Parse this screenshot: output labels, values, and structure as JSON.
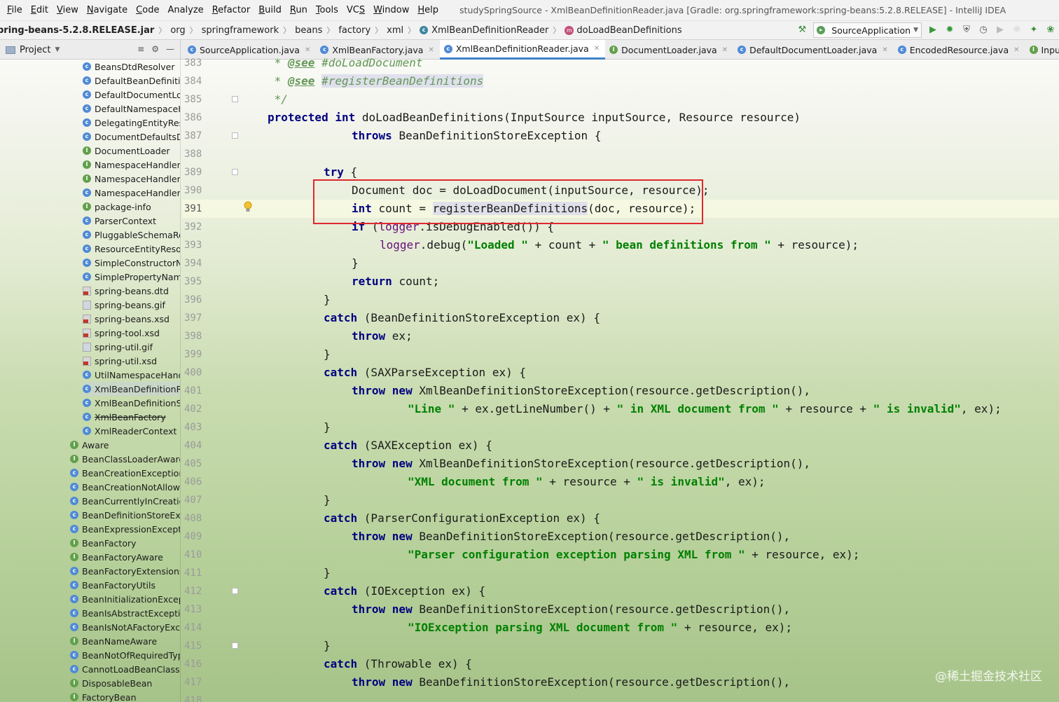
{
  "menu": {
    "items": [
      {
        "label": "File",
        "u": "F"
      },
      {
        "label": "Edit",
        "u": "E"
      },
      {
        "label": "View",
        "u": "V"
      },
      {
        "label": "Navigate",
        "u": "N"
      },
      {
        "label": "Code",
        "u": "C"
      },
      {
        "label": "Analyze",
        "u": ""
      },
      {
        "label": "Refactor",
        "u": "R"
      },
      {
        "label": "Build",
        "u": "B"
      },
      {
        "label": "Run",
        "u": "R"
      },
      {
        "label": "Tools",
        "u": "T"
      },
      {
        "label": "VCS",
        "u": "S"
      },
      {
        "label": "Window",
        "u": "W"
      },
      {
        "label": "Help",
        "u": "H"
      }
    ],
    "window_title": "studySpringSource - XmlBeanDefinitionReader.java [Gradle: org.springframework:spring-beans:5.2.8.RELEASE] - IntelliJ IDEA"
  },
  "breadcrumbs": [
    "pring-beans-5.2.8.RELEASE.jar",
    "org",
    "springframework",
    "beans",
    "factory",
    "xml",
    "XmlBeanDefinitionReader",
    "doLoadBeanDefinitions"
  ],
  "toolbar": {
    "run_config": "SourceApplication"
  },
  "project_panel": {
    "label": "Project"
  },
  "tabs": [
    {
      "label": "SourceApplication.java",
      "icon": "c"
    },
    {
      "label": "XmlBeanFactory.java",
      "icon": "c"
    },
    {
      "label": "XmlBeanDefinitionReader.java",
      "icon": "c",
      "active": true
    },
    {
      "label": "DocumentLoader.java",
      "icon": "i"
    },
    {
      "label": "DefaultDocumentLoader.java",
      "icon": "c"
    },
    {
      "label": "EncodedResource.java",
      "icon": "c"
    },
    {
      "label": "InputStreamSou",
      "icon": "i"
    }
  ],
  "tree": [
    {
      "label": "BeansDtdResolver",
      "icon": "c",
      "indent": 1
    },
    {
      "label": "DefaultBeanDefinition",
      "icon": "c",
      "indent": 1
    },
    {
      "label": "DefaultDocumentLoa",
      "icon": "c",
      "indent": 1
    },
    {
      "label": "DefaultNamespaceH",
      "icon": "c",
      "indent": 1
    },
    {
      "label": "DelegatingEntityResc",
      "icon": "c",
      "indent": 1
    },
    {
      "label": "DocumentDefaultsDe",
      "icon": "c",
      "indent": 1
    },
    {
      "label": "DocumentLoader",
      "icon": "i",
      "indent": 1
    },
    {
      "label": "NamespaceHandler",
      "icon": "i",
      "indent": 1
    },
    {
      "label": "NamespaceHandlerR",
      "icon": "i",
      "indent": 1
    },
    {
      "label": "NamespaceHandlerS",
      "icon": "c",
      "indent": 1
    },
    {
      "label": "package-info",
      "icon": "i",
      "indent": 1
    },
    {
      "label": "ParserContext",
      "icon": "c",
      "indent": 1
    },
    {
      "label": "PluggableSchemaRes",
      "icon": "c",
      "indent": 1
    },
    {
      "label": "ResourceEntityResolv",
      "icon": "c",
      "indent": 1
    },
    {
      "label": "SimpleConstructorNa",
      "icon": "c",
      "indent": 1
    },
    {
      "label": "SimplePropertyName",
      "icon": "c",
      "indent": 1
    },
    {
      "label": "spring-beans.dtd",
      "icon": "dtd",
      "indent": 1
    },
    {
      "label": "spring-beans.gif",
      "icon": "gif",
      "indent": 1
    },
    {
      "label": "spring-beans.xsd",
      "icon": "xsd",
      "indent": 1
    },
    {
      "label": "spring-tool.xsd",
      "icon": "xsd",
      "indent": 1
    },
    {
      "label": "spring-util.gif",
      "icon": "gif",
      "indent": 1
    },
    {
      "label": "spring-util.xsd",
      "icon": "xsd",
      "indent": 1
    },
    {
      "label": "UtilNamespaceHandl",
      "icon": "c",
      "indent": 1
    },
    {
      "label": "XmlBeanDefinitionRe",
      "icon": "c",
      "indent": 1,
      "selected": true
    },
    {
      "label": "XmlBeanDefinitionSto",
      "icon": "c",
      "indent": 1
    },
    {
      "label": "XmlBeanFactory",
      "icon": "c",
      "indent": 1,
      "strike": true
    },
    {
      "label": "XmlReaderContext",
      "icon": "c",
      "indent": 1
    },
    {
      "label": "Aware",
      "icon": "i",
      "indent": 0
    },
    {
      "label": "BeanClassLoaderAware",
      "icon": "i",
      "indent": 0
    },
    {
      "label": "BeanCreationException",
      "icon": "c",
      "indent": 0
    },
    {
      "label": "BeanCreationNotAllowec",
      "icon": "c",
      "indent": 0
    },
    {
      "label": "BeanCurrentlyInCreation",
      "icon": "c",
      "indent": 0
    },
    {
      "label": "BeanDefinitionStoreExce",
      "icon": "c",
      "indent": 0
    },
    {
      "label": "BeanExpressionExceptio",
      "icon": "c",
      "indent": 0
    },
    {
      "label": "BeanFactory",
      "icon": "i",
      "indent": 0
    },
    {
      "label": "BeanFactoryAware",
      "icon": "i",
      "indent": 0
    },
    {
      "label": "BeanFactoryExtensionsK",
      "icon": "c",
      "indent": 0
    },
    {
      "label": "BeanFactoryUtils",
      "icon": "c",
      "indent": 0
    },
    {
      "label": "BeanInitializationExcepti",
      "icon": "c",
      "indent": 0
    },
    {
      "label": "BeanIsAbstractException",
      "icon": "c",
      "indent": 0
    },
    {
      "label": "BeanIsNotAFactoryExcep",
      "icon": "c",
      "indent": 0
    },
    {
      "label": "BeanNameAware",
      "icon": "i",
      "indent": 0
    },
    {
      "label": "BeanNotOfRequiredTyp",
      "icon": "c",
      "indent": 0
    },
    {
      "label": "CannotLoadBeanClassEx",
      "icon": "c",
      "indent": 0
    },
    {
      "label": "DisposableBean",
      "icon": "i",
      "indent": 0
    },
    {
      "label": "FactoryBean",
      "icon": "i",
      "indent": 0
    }
  ],
  "line_numbers": [
    "383",
    "384",
    "385",
    "386",
    "387",
    "388",
    "389",
    "390",
    "391",
    "392",
    "393",
    "394",
    "395",
    "396",
    "397",
    "398",
    "399",
    "400",
    "401",
    "402",
    "403",
    "404",
    "405",
    "406",
    "407",
    "408",
    "409",
    "410",
    "411",
    "412",
    "413",
    "414",
    "415",
    "416",
    "417",
    "418"
  ],
  "current_line": "391",
  "code_lines": [
    {
      "indent": 1,
      "tokens": [
        [
          "doc",
          " * "
        ],
        [
          "tag",
          "@see"
        ],
        [
          "doc",
          " #doLoadDocument"
        ]
      ]
    },
    {
      "indent": 1,
      "tokens": [
        [
          "doc",
          " * "
        ],
        [
          "tag",
          "@see"
        ],
        [
          "doc",
          " "
        ],
        [
          "dochl",
          "#registerBeanDefinitions"
        ]
      ]
    },
    {
      "indent": 1,
      "tokens": [
        [
          "doc",
          " */"
        ]
      ]
    },
    {
      "indent": 1,
      "tokens": [
        [
          "kw",
          "protected int "
        ],
        [
          "t",
          "doLoadBeanDefinitions(InputSource inputSource, Resource resource)"
        ]
      ]
    },
    {
      "indent": 3,
      "tokens": [
        [
          "kw",
          "throws "
        ],
        [
          "t",
          "BeanDefinitionStoreException {"
        ]
      ]
    },
    {
      "indent": 0,
      "tokens": []
    },
    {
      "indent": 2,
      "tokens": [
        [
          "kw",
          "try "
        ],
        [
          "t",
          "{"
        ]
      ]
    },
    {
      "indent": 3,
      "tokens": [
        [
          "t",
          "Document doc = doLoadDocument(inputSource, resource);"
        ]
      ]
    },
    {
      "indent": 3,
      "tokens": [
        [
          "kw",
          "int "
        ],
        [
          "t",
          "count = "
        ],
        [
          "hl",
          "registerBeanDefinitions"
        ],
        [
          "t",
          "(doc, resource);"
        ]
      ]
    },
    {
      "indent": 3,
      "tokens": [
        [
          "kw",
          "if "
        ],
        [
          "t",
          "("
        ],
        [
          "fld",
          "logger"
        ],
        [
          "t",
          ".isDebugEnabled()) {"
        ]
      ]
    },
    {
      "indent": 4,
      "tokens": [
        [
          "fld",
          "logger"
        ],
        [
          "t",
          ".debug("
        ],
        [
          "str",
          "\"Loaded \""
        ],
        [
          "t",
          " + count + "
        ],
        [
          "str",
          "\" bean definitions from \""
        ],
        [
          "t",
          " + resource);"
        ]
      ]
    },
    {
      "indent": 3,
      "tokens": [
        [
          "t",
          "}"
        ]
      ]
    },
    {
      "indent": 3,
      "tokens": [
        [
          "kw",
          "return "
        ],
        [
          "t",
          "count;"
        ]
      ]
    },
    {
      "indent": 2,
      "tokens": [
        [
          "t",
          "}"
        ]
      ]
    },
    {
      "indent": 2,
      "tokens": [
        [
          "kw",
          "catch "
        ],
        [
          "t",
          "(BeanDefinitionStoreException ex) {"
        ]
      ]
    },
    {
      "indent": 3,
      "tokens": [
        [
          "kw",
          "throw "
        ],
        [
          "t",
          "ex;"
        ]
      ]
    },
    {
      "indent": 2,
      "tokens": [
        [
          "t",
          "}"
        ]
      ]
    },
    {
      "indent": 2,
      "tokens": [
        [
          "kw",
          "catch "
        ],
        [
          "t",
          "(SAXParseException ex) {"
        ]
      ]
    },
    {
      "indent": 3,
      "tokens": [
        [
          "kw",
          "throw new "
        ],
        [
          "t",
          "XmlBeanDefinitionStoreException(resource.getDescription(),"
        ]
      ]
    },
    {
      "indent": 5,
      "tokens": [
        [
          "str",
          "\"Line \""
        ],
        [
          "t",
          " + ex.getLineNumber() + "
        ],
        [
          "str",
          "\" in XML document from \""
        ],
        [
          "t",
          " + resource + "
        ],
        [
          "str",
          "\" is invalid\""
        ],
        [
          "t",
          ", ex);"
        ]
      ]
    },
    {
      "indent": 2,
      "tokens": [
        [
          "t",
          "}"
        ]
      ]
    },
    {
      "indent": 2,
      "tokens": [
        [
          "kw",
          "catch "
        ],
        [
          "t",
          "(SAXException ex) {"
        ]
      ]
    },
    {
      "indent": 3,
      "tokens": [
        [
          "kw",
          "throw new "
        ],
        [
          "t",
          "XmlBeanDefinitionStoreException(resource.getDescription(),"
        ]
      ]
    },
    {
      "indent": 5,
      "tokens": [
        [
          "str",
          "\"XML document from \""
        ],
        [
          "t",
          " + resource + "
        ],
        [
          "str",
          "\" is invalid\""
        ],
        [
          "t",
          ", ex);"
        ]
      ]
    },
    {
      "indent": 2,
      "tokens": [
        [
          "t",
          "}"
        ]
      ]
    },
    {
      "indent": 2,
      "tokens": [
        [
          "kw",
          "catch "
        ],
        [
          "t",
          "(ParserConfigurationException ex) {"
        ]
      ]
    },
    {
      "indent": 3,
      "tokens": [
        [
          "kw",
          "throw new "
        ],
        [
          "t",
          "BeanDefinitionStoreException(resource.getDescription(),"
        ]
      ]
    },
    {
      "indent": 5,
      "tokens": [
        [
          "str",
          "\"Parser configuration exception parsing XML from \""
        ],
        [
          "t",
          " + resource, ex);"
        ]
      ]
    },
    {
      "indent": 2,
      "tokens": [
        [
          "t",
          "}"
        ]
      ]
    },
    {
      "indent": 2,
      "tokens": [
        [
          "kw",
          "catch "
        ],
        [
          "t",
          "(IOException ex) {"
        ]
      ]
    },
    {
      "indent": 3,
      "tokens": [
        [
          "kw",
          "throw new "
        ],
        [
          "t",
          "BeanDefinitionStoreException(resource.getDescription(),"
        ]
      ]
    },
    {
      "indent": 5,
      "tokens": [
        [
          "str",
          "\"IOException parsing XML document from \""
        ],
        [
          "t",
          " + resource, ex);"
        ]
      ]
    },
    {
      "indent": 2,
      "tokens": [
        [
          "t",
          "}"
        ]
      ]
    },
    {
      "indent": 2,
      "tokens": [
        [
          "kw",
          "catch "
        ],
        [
          "t",
          "(Throwable ex) {"
        ]
      ]
    },
    {
      "indent": 3,
      "tokens": [
        [
          "kw",
          "throw new "
        ],
        [
          "t",
          "BeanDefinitionStoreException(resource.getDescription(),"
        ]
      ]
    }
  ],
  "watermark": "@稀土掘金技术社区",
  "colors": {
    "keyword": "#000080",
    "string": "#008000",
    "doc": "#629755",
    "field": "#660e7a",
    "highlight_box": "#e0282e",
    "tab_active": "#4083c9"
  }
}
